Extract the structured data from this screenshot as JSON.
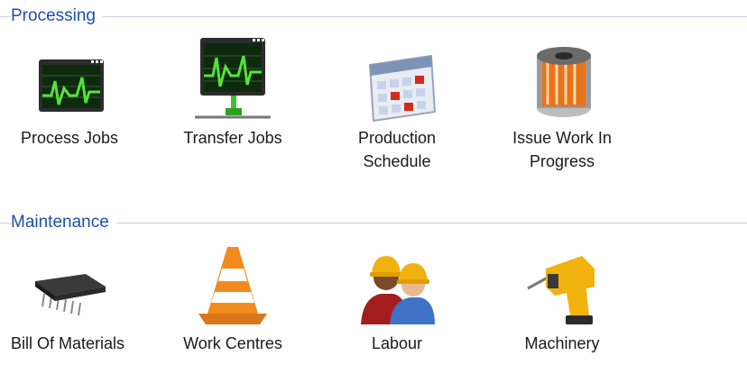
{
  "sections": [
    {
      "title": "Processing",
      "tiles": [
        {
          "label": "Process Jobs",
          "icon": "monitor-waveform-icon"
        },
        {
          "label": "Transfer Jobs",
          "icon": "network-monitor-waveform-icon"
        },
        {
          "label": "Production Schedule",
          "icon": "calendar-icon"
        },
        {
          "label": "Issue Work In Progress",
          "icon": "spool-icon"
        }
      ]
    },
    {
      "title": "Maintenance",
      "tiles": [
        {
          "label": "Bill Of Materials",
          "icon": "microchip-icon"
        },
        {
          "label": "Work Centres",
          "icon": "traffic-cone-icon"
        },
        {
          "label": "Labour",
          "icon": "workers-hardhat-icon"
        },
        {
          "label": "Machinery",
          "icon": "power-drill-icon"
        }
      ]
    }
  ]
}
